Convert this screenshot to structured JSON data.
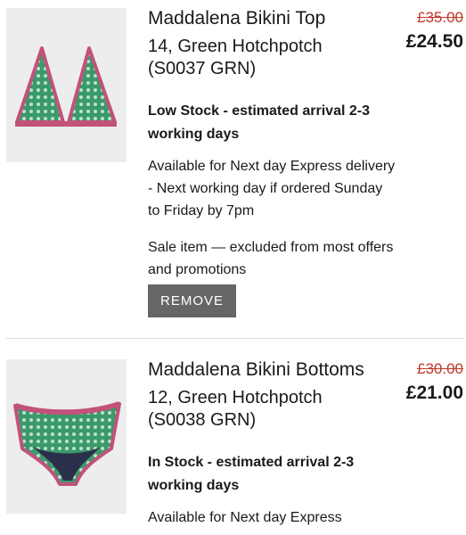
{
  "items": [
    {
      "name": "Maddalena Bikini Top",
      "variant_line1": "14, Green Hotchpotch",
      "variant_line2": "(S0037 GRN)",
      "stock": "Low Stock - estimated arrival 2-3 working days",
      "delivery": "Available for Next day Express delivery - Next working day if ordered Sunday to Friday by 7pm",
      "sale_note": "Sale item — excluded from most offers and promotions",
      "remove_label": "REMOVE",
      "original_price": "£35.00",
      "sale_price": "£24.50"
    },
    {
      "name": "Maddalena Bikini Bottoms",
      "variant_line1": "12, Green Hotchpotch",
      "variant_line2": "(S0038 GRN)",
      "stock": "In Stock - estimated arrival 2-3 working days",
      "delivery": "Available for Next day Express",
      "original_price": "£30.00",
      "sale_price": "£21.00"
    }
  ],
  "colors": {
    "fabric_green": "#3a9a6a",
    "trim_pink": "#c2527a",
    "strike_red": "#c0392b",
    "remove_button": "#666666"
  }
}
